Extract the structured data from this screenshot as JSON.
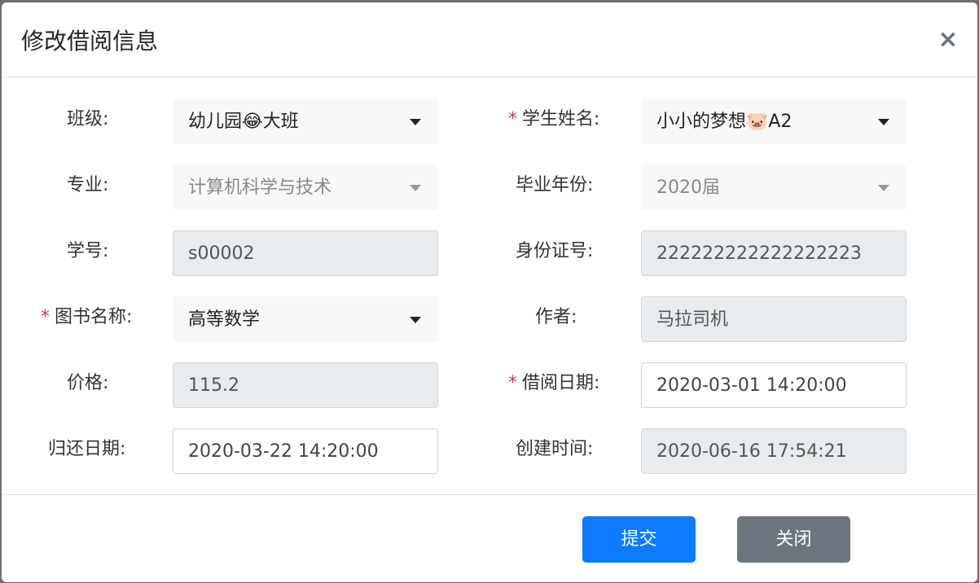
{
  "modal": {
    "title": "修改借阅信息",
    "close_label": "×"
  },
  "required_marker": "*",
  "fields": {
    "class": {
      "label": "班级:",
      "value": "幼儿园😂大班"
    },
    "student_name": {
      "label": "学生姓名:",
      "value": "小小的梦想🐷A2",
      "required": true
    },
    "major": {
      "label": "专业:",
      "value": "计算机科学与技术"
    },
    "grad_year": {
      "label": "毕业年份:",
      "value": "2020届"
    },
    "student_no": {
      "label": "学号:",
      "value": "s00002"
    },
    "id_card": {
      "label": "身份证号:",
      "value": "222222222222222223"
    },
    "book_name": {
      "label": "图书名称:",
      "value": "高等数学",
      "required": true
    },
    "author": {
      "label": "作者:",
      "value": "马拉司机"
    },
    "price": {
      "label": "价格:",
      "value": "115.2"
    },
    "borrow_date": {
      "label": "借阅日期:",
      "value": "2020-03-01 14:20:00",
      "required": true
    },
    "return_date": {
      "label": "归还日期:",
      "value": "2020-03-22 14:20:00"
    },
    "create_time": {
      "label": "创建时间:",
      "value": "2020-06-16 17:54:21"
    }
  },
  "footer": {
    "submit_label": "提交",
    "close_label": "关闭"
  },
  "colors": {
    "primary": "#0d7bff",
    "secondary": "#6c757d",
    "required": "#dc3545"
  }
}
